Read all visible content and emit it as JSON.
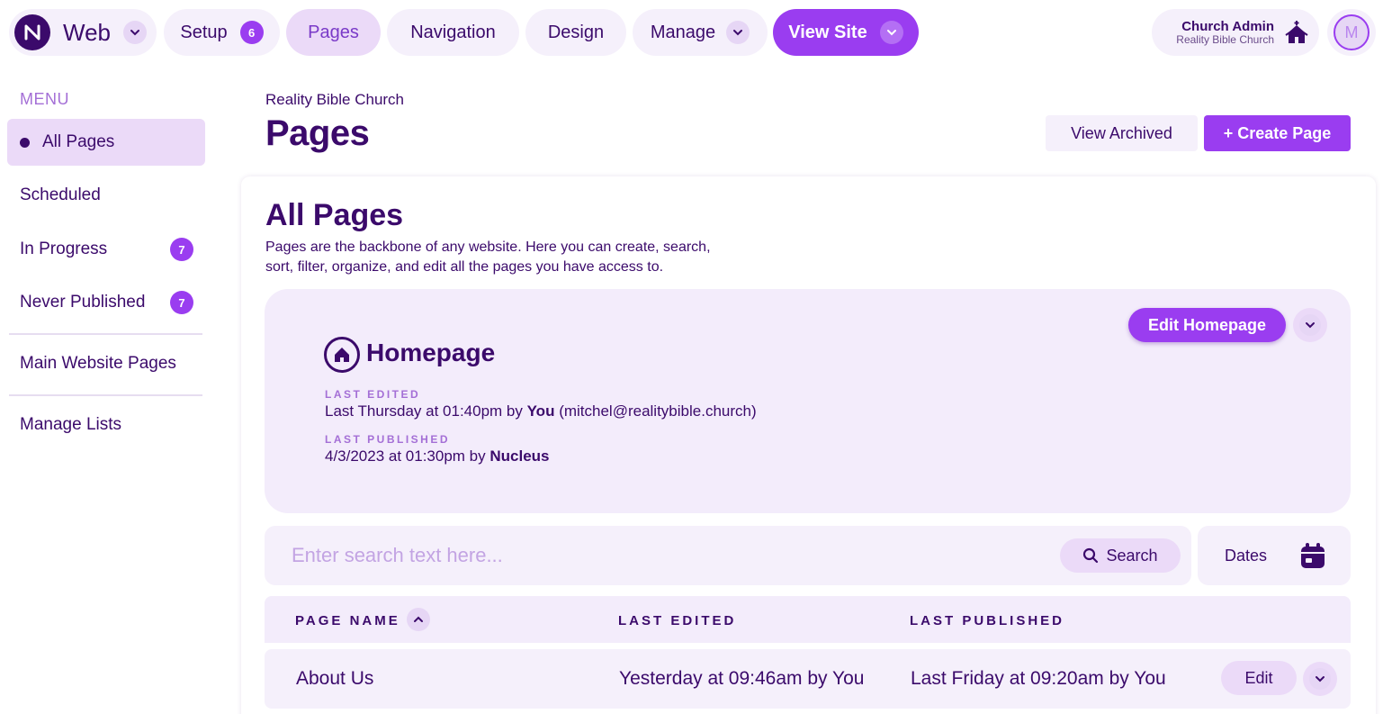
{
  "topnav": {
    "app_name": "Web",
    "setup_label": "Setup",
    "setup_count": "6",
    "pages_label": "Pages",
    "navigation_label": "Navigation",
    "design_label": "Design",
    "manage_label": "Manage",
    "view_site_label": "View Site",
    "admin_name": "Church Admin",
    "admin_org": "Reality Bible Church",
    "avatar_initial": "M"
  },
  "sidebar": {
    "heading": "MENU",
    "items": [
      {
        "label": "All Pages",
        "active": true
      },
      {
        "label": "Scheduled"
      },
      {
        "label": "In Progress",
        "count": "7"
      },
      {
        "label": "Never Published",
        "count": "7"
      },
      {
        "label": "Main Website Pages"
      },
      {
        "label": "Manage Lists"
      }
    ]
  },
  "header": {
    "org": "Reality Bible Church",
    "title": "Pages",
    "view_archived_label": "View Archived",
    "create_page_label": "+ Create Page"
  },
  "main": {
    "title": "All Pages",
    "description": "Pages are the backbone of any website. Here you can create, search, sort, filter, organize, and edit all the pages you have access to."
  },
  "homepage": {
    "title": "Homepage",
    "edit_label": "Edit Homepage",
    "last_edited_label": "LAST EDITED",
    "last_edited_text": "Last Thursday at 01:40pm by ",
    "last_edited_user": "You",
    "last_edited_email": " (mitchel@realitybible.church)",
    "last_published_label": "LAST PUBLISHED",
    "last_published_text": "4/3/2023 at 01:30pm by ",
    "last_published_user": "Nucleus"
  },
  "search": {
    "placeholder": "Enter search text here...",
    "button_label": "Search",
    "dates_label": "Dates"
  },
  "table": {
    "columns": [
      "PAGE NAME",
      "LAST EDITED",
      "LAST PUBLISHED"
    ],
    "rows": [
      {
        "name": "About Us",
        "last_edited": "Yesterday at 09:46am by You",
        "last_published": "Last Friday at 09:20am by You",
        "edit_label": "Edit"
      }
    ]
  },
  "colors": {
    "primary": "#9a3df0",
    "text": "#3b0a6b",
    "surface": "#f5f0fb",
    "surface_active": "#ebdaf8"
  }
}
